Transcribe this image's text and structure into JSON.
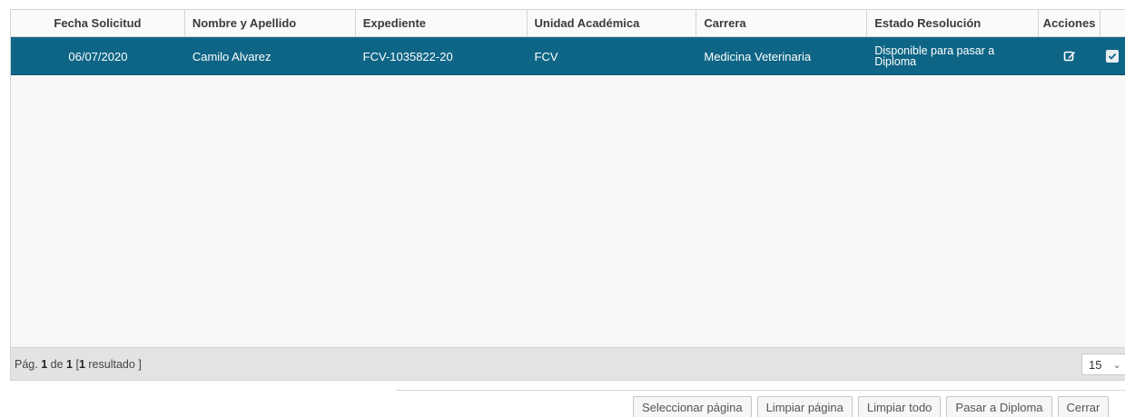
{
  "table": {
    "headers": {
      "fecha": "Fecha Solicitud",
      "nombre": "Nombre y Apellido",
      "expediente": "Expediente",
      "unidad": "Unidad Académica",
      "carrera": "Carrera",
      "estado": "Estado Resolución",
      "acciones": "Acciones"
    },
    "rows": [
      {
        "fecha": "06/07/2020",
        "nombre": "Camilo Alvarez",
        "expediente": "FCV-1035822-20",
        "unidad": "FCV",
        "carrera": "Medicina Veterinaria",
        "estado": "Disponible para pasar a Diploma",
        "edit_icon": "edit-icon",
        "check_icon": "checkbox-checked-icon",
        "selected": true
      }
    ]
  },
  "pager": {
    "prefix": "Pág.",
    "current": "1",
    "of": "de",
    "total": "1",
    "bracket_open": "[",
    "count": "1",
    "count_label": "resultado",
    "bracket_close": "]",
    "page_size": "15"
  },
  "buttons": {
    "select_page": "Seleccionar página",
    "clear_page": "Limpiar página",
    "clear_all": "Limpiar todo",
    "to_diploma": "Pasar a Diploma",
    "close": "Cerrar"
  },
  "colors": {
    "selected_row": "#0e6586",
    "footer_bg": "#e3e3e3"
  }
}
